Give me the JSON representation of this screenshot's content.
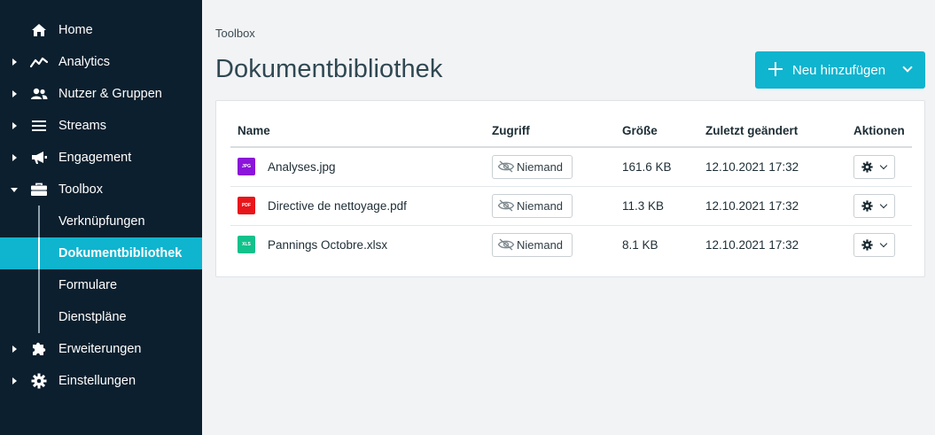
{
  "sidebar": {
    "items": [
      {
        "label": "Home",
        "icon": "home-icon",
        "caret": "none"
      },
      {
        "label": "Analytics",
        "icon": "analytics-icon",
        "caret": "right"
      },
      {
        "label": "Nutzer & Gruppen",
        "icon": "users-icon",
        "caret": "right"
      },
      {
        "label": "Streams",
        "icon": "streams-icon",
        "caret": "right"
      },
      {
        "label": "Engagement",
        "icon": "megaphone-icon",
        "caret": "right"
      },
      {
        "label": "Toolbox",
        "icon": "toolbox-icon",
        "caret": "down"
      },
      {
        "label": "Erweiterungen",
        "icon": "puzzle-icon",
        "caret": "right"
      },
      {
        "label": "Einstellungen",
        "icon": "gear-icon",
        "caret": "right"
      }
    ],
    "toolbox_sub": [
      {
        "label": "Verknüpfungen",
        "active": false
      },
      {
        "label": "Dokumentbibliothek",
        "active": true
      },
      {
        "label": "Formulare",
        "active": false
      },
      {
        "label": "Dienstpläne",
        "active": false
      }
    ]
  },
  "breadcrumb": "Toolbox",
  "page_title": "Dokumentbibliothek",
  "add_button_label": "Neu hinzufügen",
  "table": {
    "headers": {
      "name": "Name",
      "access": "Zugriff",
      "size": "Größe",
      "modified": "Zuletzt geändert",
      "actions": "Aktionen"
    },
    "rows": [
      {
        "type": "JPG",
        "type_color": "#8b15d9",
        "name": "Analyses.jpg",
        "access": "Niemand",
        "size": "161.6 KB",
        "modified": "12.10.2021 17:32"
      },
      {
        "type": "PDF",
        "type_color": "#e8161b",
        "name": "Directive de nettoyage.pdf",
        "access": "Niemand",
        "size": "11.3 KB",
        "modified": "12.10.2021 17:32"
      },
      {
        "type": "XLS",
        "type_color": "#13c18b",
        "name": "Pannings Octobre.xlsx",
        "access": "Niemand",
        "size": "8.1 KB",
        "modified": "12.10.2021 17:32"
      }
    ]
  },
  "colors": {
    "sidebar_bg": "#0c1f2e",
    "accent": "#0fb4cf",
    "page_bg": "#f2f3f5"
  }
}
